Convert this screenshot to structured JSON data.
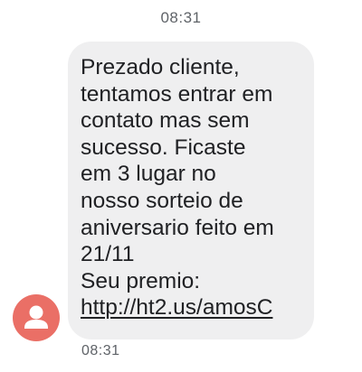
{
  "header": {
    "time": "08:31"
  },
  "message": {
    "lines": [
      "Prezado cliente,",
      "tentamos entrar em",
      "contato mas sem",
      "sucesso. Ficaste",
      "em 3 lugar no",
      "nosso sorteio de",
      "aniversario feito em",
      "21/11",
      "Seu premio:"
    ],
    "link": "http://ht2.us/amosC",
    "time": "08:31"
  },
  "sender": {
    "avatar_icon": "person-icon",
    "avatar_color": "#ea6f66"
  },
  "colors": {
    "bubble": "#efeff0",
    "text": "#202124",
    "timestamp": "#5f6368"
  }
}
